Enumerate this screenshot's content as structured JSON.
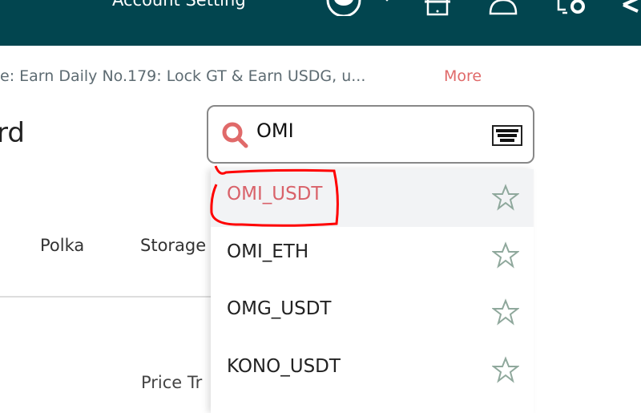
{
  "header": {
    "account_setting": "Account Setting",
    "icons": [
      "avatar-icon",
      "store-icon",
      "service-bell-icon",
      "device-settings-icon",
      "share-icon"
    ],
    "background": "#02454f"
  },
  "notice": {
    "text": "e:  Earn Daily No.179: Lock GT & Earn USDG, u...",
    "more": "More",
    "more_color": "#e06a6a"
  },
  "page_title": "rd",
  "search": {
    "value": "OMI",
    "icon": "search-icon",
    "keyboard_icon": "keyboard-icon",
    "accent": "#e06a6a"
  },
  "tabs": [
    {
      "label": "Polka"
    },
    {
      "label": "Storage"
    }
  ],
  "section_label": "Price Tr",
  "dropdown": {
    "items": [
      {
        "label": "OMI_USDT",
        "highlighted": true
      },
      {
        "label": "OMI_ETH"
      },
      {
        "label": "OMG_USDT"
      },
      {
        "label": "KONO_USDT"
      }
    ]
  }
}
